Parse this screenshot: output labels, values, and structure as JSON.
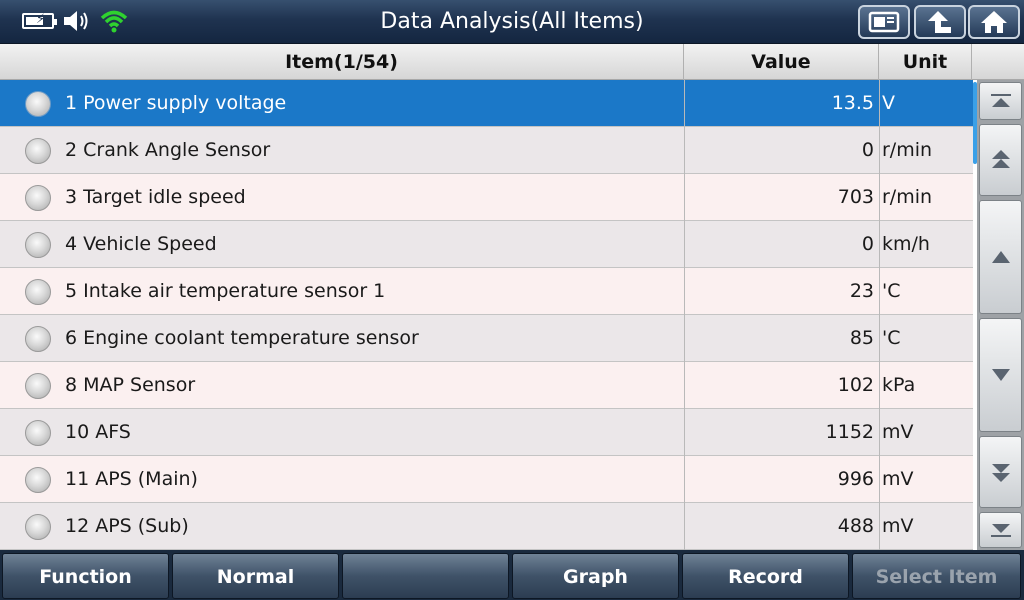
{
  "window": {
    "title": "Data Analysis(All Items)"
  },
  "status": {
    "battery": "battery-charging-icon",
    "sound": "speaker-icon",
    "wifi": "wifi-icon"
  },
  "toolbar": {
    "buttons": [
      "screenshot-icon",
      "back-icon",
      "home-icon"
    ]
  },
  "table": {
    "headers": {
      "item": "Item(1/54)",
      "value": "Value",
      "unit": "Unit"
    },
    "rows": [
      {
        "name": "1 Power supply voltage",
        "value": "13.5",
        "unit": "V",
        "selected": true
      },
      {
        "name": "2 Crank Angle Sensor",
        "value": "0",
        "unit": "r/min"
      },
      {
        "name": "3 Target idle speed",
        "value": "703",
        "unit": "r/min"
      },
      {
        "name": "4 Vehicle Speed",
        "value": "0",
        "unit": "km/h"
      },
      {
        "name": "5 Intake air temperature sensor 1",
        "value": "23",
        "unit": "'C"
      },
      {
        "name": "6 Engine coolant temperature sensor",
        "value": "85",
        "unit": "'C"
      },
      {
        "name": "8 MAP Sensor",
        "value": "102",
        "unit": "kPa"
      },
      {
        "name": "10 AFS",
        "value": "1152",
        "unit": "mV"
      },
      {
        "name": "11 APS (Main)",
        "value": "996",
        "unit": "mV"
      },
      {
        "name": "12 APS (Sub)",
        "value": "488",
        "unit": "mV"
      }
    ]
  },
  "scroll": {
    "buttons": [
      "scroll-top-icon",
      "page-up-icon",
      "line-up-icon",
      "line-down-icon",
      "page-down-icon",
      "scroll-bottom-icon"
    ]
  },
  "bottombar": {
    "function": "Function",
    "normal": "Normal",
    "empty": "",
    "graph": "Graph",
    "record": "Record",
    "select_item": "Select Item"
  },
  "colors": {
    "selected_row": "#1b78c8",
    "titlebar": "#1f3350",
    "scroll_indicator": "#3aa0e8"
  }
}
